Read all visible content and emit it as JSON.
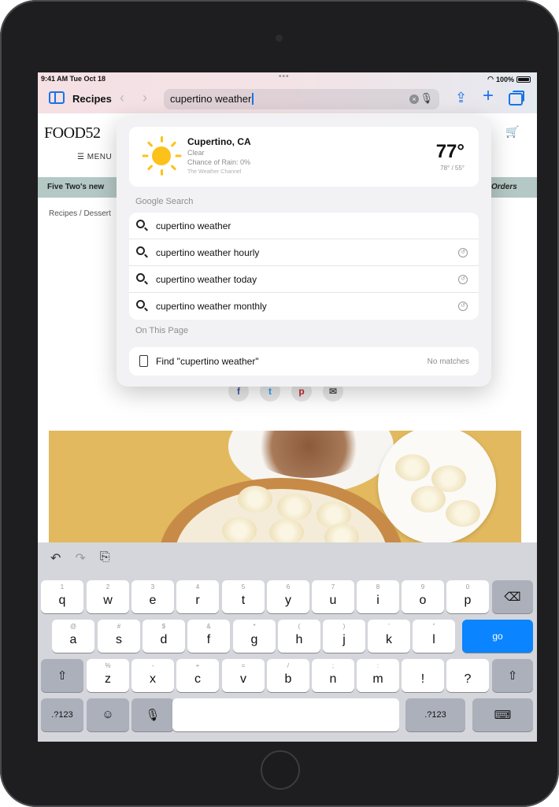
{
  "status_bar": {
    "time": "9:41 AM  Tue Oct 18",
    "dots": "•••",
    "battery": "100%"
  },
  "toolbar": {
    "tab_group": "Recipes",
    "back_icon": "‹",
    "forward_icon": "›",
    "url_text": "cupertino weather",
    "clear_icon": "×",
    "mic_icon": "🎙",
    "share_icon": "⇪",
    "new_tab_icon": "+"
  },
  "webpage": {
    "logo": "FOOD52",
    "menu": "☰  MENU",
    "banner_left": "Five Two's new",
    "banner_right": "Orders",
    "breadcrumb": "Recipes / Dessert",
    "share_icons": [
      "f",
      "t",
      "p",
      "✉"
    ],
    "cart_icon": "🛒"
  },
  "weather": {
    "city": "Cupertino, CA",
    "condition": "Clear",
    "rain": "Chance of Rain: 0%",
    "source": "The Weather Channel",
    "temp": "77°",
    "range": "78° / 55°"
  },
  "search": {
    "section_title": "Google Search",
    "results": [
      {
        "text": "cupertino weather",
        "history": false
      },
      {
        "text": "cupertino weather hourly",
        "history": true
      },
      {
        "text": "cupertino weather today",
        "history": true
      },
      {
        "text": "cupertino weather monthly",
        "history": true
      }
    ]
  },
  "on_page": {
    "section_title": "On This Page",
    "find_text": "Find \"cupertino weather\"",
    "status": "No matches"
  },
  "keyboard": {
    "tools": [
      "↶",
      "↷",
      "⎘"
    ],
    "row1": [
      {
        "main": "q",
        "alt": "1"
      },
      {
        "main": "w",
        "alt": "2"
      },
      {
        "main": "e",
        "alt": "3"
      },
      {
        "main": "r",
        "alt": "4"
      },
      {
        "main": "t",
        "alt": "5"
      },
      {
        "main": "y",
        "alt": "6"
      },
      {
        "main": "u",
        "alt": "7"
      },
      {
        "main": "i",
        "alt": "8"
      },
      {
        "main": "o",
        "alt": "9"
      },
      {
        "main": "p",
        "alt": "0"
      }
    ],
    "row2": [
      {
        "main": "a",
        "alt": "@"
      },
      {
        "main": "s",
        "alt": "#"
      },
      {
        "main": "d",
        "alt": "$"
      },
      {
        "main": "f",
        "alt": "&"
      },
      {
        "main": "g",
        "alt": "*"
      },
      {
        "main": "h",
        "alt": "("
      },
      {
        "main": "j",
        "alt": ")"
      },
      {
        "main": "k",
        "alt": "'"
      },
      {
        "main": "l",
        "alt": "\""
      }
    ],
    "row3": [
      {
        "main": "z",
        "alt": "%"
      },
      {
        "main": "x",
        "alt": "-"
      },
      {
        "main": "c",
        "alt": "+"
      },
      {
        "main": "v",
        "alt": "="
      },
      {
        "main": "b",
        "alt": "/"
      },
      {
        "main": "n",
        "alt": ";"
      },
      {
        "main": "m",
        "alt": ":"
      },
      {
        "main": "!",
        "alt": ""
      },
      {
        "main": "?",
        "alt": ""
      }
    ],
    "delete": "⌫",
    "go": "go",
    "shift": "⇧",
    "numbers": ".?123",
    "emoji": "☺",
    "mic": "🎙",
    "hide": "⌨"
  }
}
